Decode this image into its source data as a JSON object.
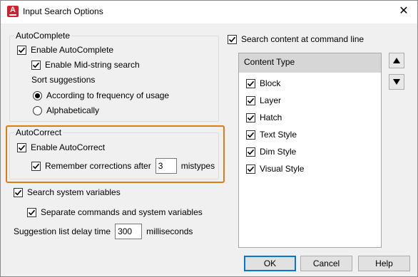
{
  "window": {
    "title": "Input Search Options",
    "close_glyph": "✕"
  },
  "autocomplete": {
    "legend": "AutoComplete",
    "enable_label": "Enable AutoComplete",
    "enable_checked": true,
    "midstring_label": "Enable Mid-string search",
    "midstring_checked": true,
    "sort_label": "Sort suggestions",
    "sort_options": [
      "According to frequency of usage",
      "Alphabetically"
    ],
    "sort_selected": "According to frequency of usage"
  },
  "autocorrect": {
    "legend": "AutoCorrect",
    "enable_label": "Enable AutoCorrect",
    "enable_checked": true,
    "remember_label": "Remember corrections after",
    "remember_checked": true,
    "remember_value": "3",
    "remember_suffix": "mistypes",
    "highlight_color": "#e07a12"
  },
  "system": {
    "search_sysvars_label": "Search system variables",
    "search_sysvars_checked": true,
    "separate_label": "Separate commands and system variables",
    "separate_checked": true,
    "delay_label": "Suggestion list delay time",
    "delay_value": "300",
    "delay_suffix": "milliseconds"
  },
  "content": {
    "search_label": "Search content at command line",
    "search_checked": true,
    "header": "Content Type",
    "items": [
      {
        "label": "Block",
        "checked": true
      },
      {
        "label": "Layer",
        "checked": true
      },
      {
        "label": "Hatch",
        "checked": true
      },
      {
        "label": "Text Style",
        "checked": true
      },
      {
        "label": "Dim Style",
        "checked": true
      },
      {
        "label": "Visual Style",
        "checked": true
      }
    ],
    "move_up_icon": "triangle-up-icon",
    "move_down_icon": "triangle-down-icon"
  },
  "buttons": {
    "ok": "OK",
    "cancel": "Cancel",
    "help": "Help"
  }
}
